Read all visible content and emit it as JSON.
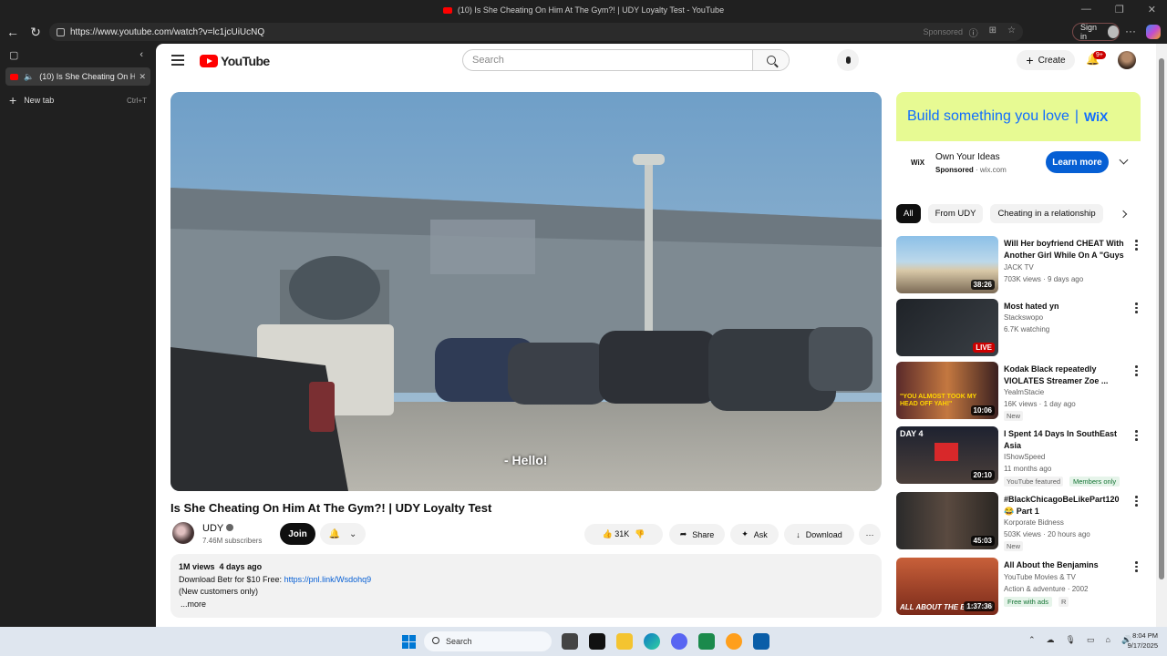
{
  "window": {
    "title": "(10) Is She Cheating On Him At The Gym?! | UDY Loyalty Test - YouTube"
  },
  "browser": {
    "url": "https://www.youtube.com/watch?v=lc1jcUiUcNQ",
    "sponsored_label": "Sponsored",
    "sign_in": "Sign in",
    "tab_title": "(10) Is She Cheating On Him At The Gym?! | UDY Loyalty Test - YouTube",
    "new_tab": "New tab",
    "new_tab_shortcut": "Ctrl+T"
  },
  "header": {
    "logo": "YouTube",
    "search_placeholder": "Search",
    "create": "Create",
    "notifications": "9+"
  },
  "video": {
    "subtitle": "- Hello!",
    "title": "Is She Cheating On Him At The Gym?! | UDY Loyalty Test",
    "channel": "UDY",
    "subscribers": "7.46M subscribers",
    "join": "Join",
    "likes": "31K",
    "share": "Share",
    "ask": "Ask",
    "download": "Download",
    "views": "1M views",
    "age": "4 days ago",
    "desc_line1": "Download Betr for $10 Free: ",
    "desc_link": "https://pnl.link/Wsdohq9",
    "desc_line2": "(New customers only)",
    "more": "...more"
  },
  "ad": {
    "banner": "Build something you love",
    "banner_brand": "WiX",
    "logo": "WiX",
    "title": "Own Your Ideas",
    "sponsored": "Sponsored",
    "domain": "· wix.com",
    "cta": "Learn more"
  },
  "chips": [
    "All",
    "From UDY",
    "Cheating in a relationship"
  ],
  "recommendations": [
    {
      "title": "Will Her boyfriend CHEAT With Another Girl While On A \"Guys ...",
      "channel": "JACK TV",
      "meta": "703K views · 9 days ago",
      "duration": "38:26"
    },
    {
      "title": "Most hated yn",
      "channel": "Stackswopo",
      "meta": "6.7K watching",
      "duration": "LIVE"
    },
    {
      "title": "Kodak Black repeatedly VIOLATES Streamer Zoe ...",
      "channel": "YealmStacie",
      "meta": "16K views · 1 day ago",
      "badge": "New",
      "duration": "10:06",
      "thumb_text": "\"YOU ALMOST TOOK MY HEAD OFF YAH!\""
    },
    {
      "title": "I Spent 14 Days In SouthEast Asia",
      "channel": "IShowSpeed",
      "meta": "11 months ago",
      "badge": "YouTube featured",
      "members": "Members only",
      "duration": "20:10",
      "thumb_text": "DAY 4"
    },
    {
      "title": "#BlackChicagoBeLikePart120 😂 Part 1",
      "channel": "Korporate Bidness",
      "meta": "503K views · 20 hours ago",
      "badge": "New",
      "duration": "45:03"
    },
    {
      "title": "All About the Benjamins",
      "channel": "YouTube Movies & TV",
      "meta": "Action & adventure · 2002",
      "badge": "Free with ads",
      "rating": "R",
      "duration": "1:37:36",
      "thumb_text": "ALL ABOUT THE BENJAMI"
    }
  ],
  "taskbar": {
    "search": "Search",
    "time": "8:04 PM",
    "date": "9/17/2025"
  }
}
